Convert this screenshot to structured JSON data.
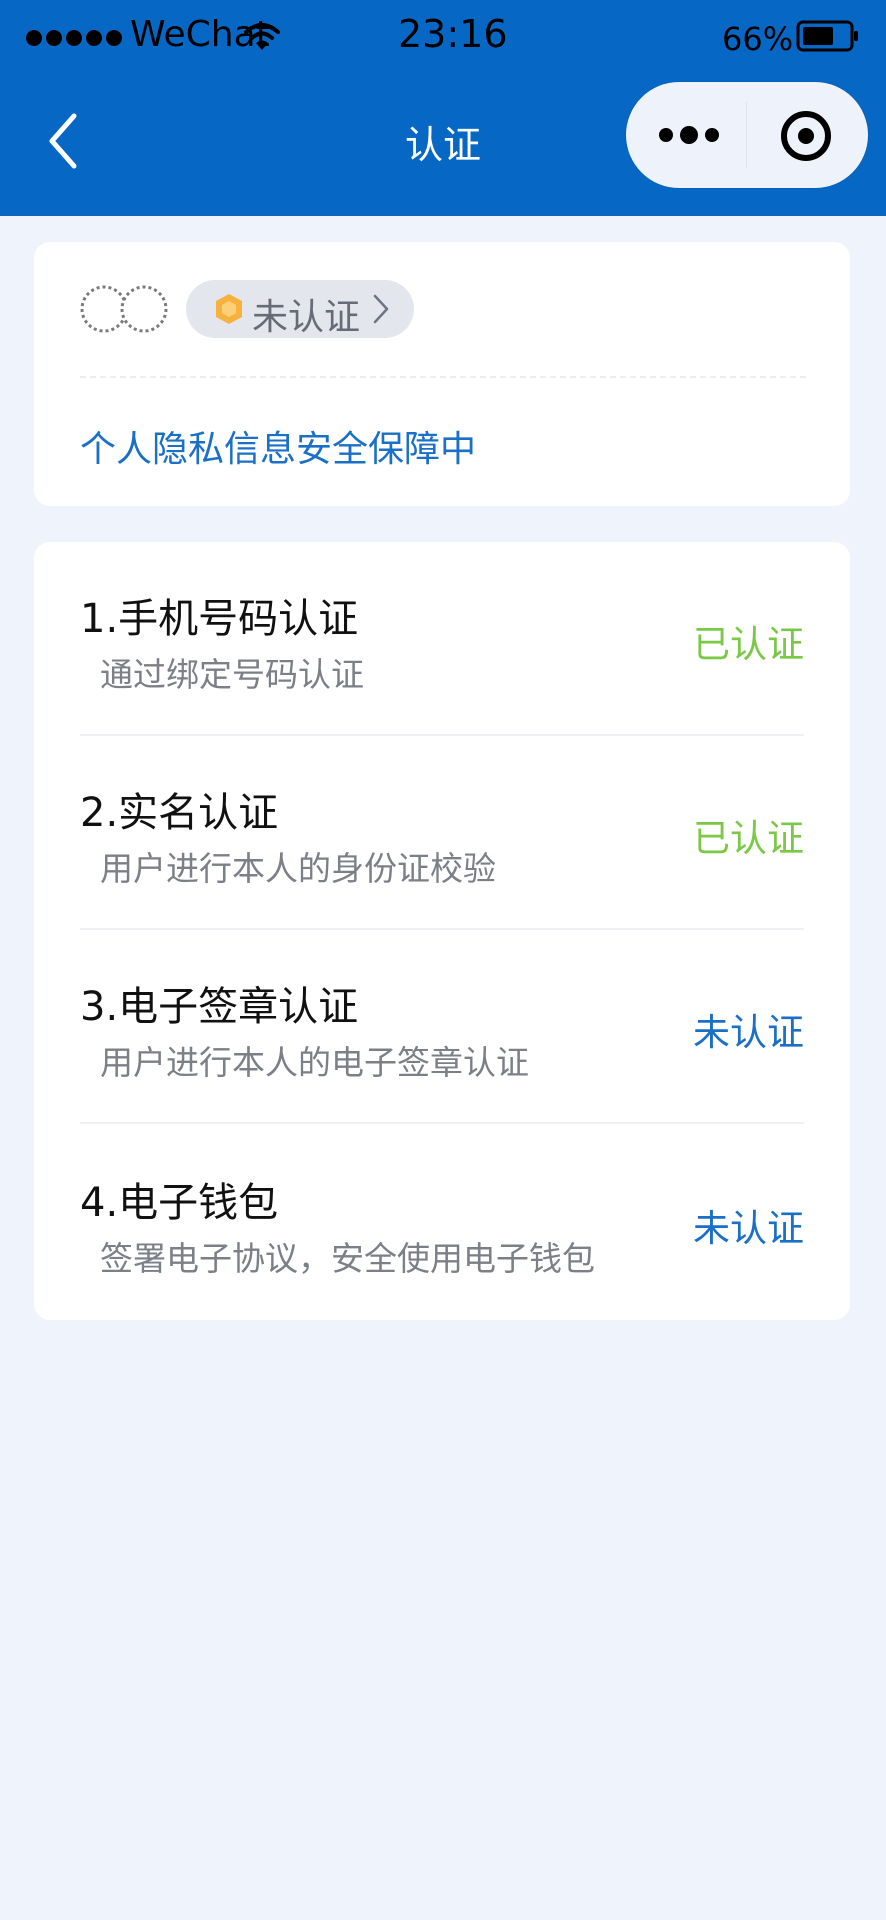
{
  "status_bar": {
    "carrier": "WeChat",
    "time": "23:16",
    "battery": "66%",
    "icons": [
      "signal-dots-icon",
      "wifi-icon",
      "battery-icon"
    ]
  },
  "nav": {
    "title": "认证",
    "icons": [
      "back-icon",
      "more-icon",
      "close-target-icon"
    ]
  },
  "user_card": {
    "badge_label": "未认证",
    "privacy_text": "个人隐私信息安全保障中",
    "icons": [
      "avatar",
      "shield-icon",
      "chevron-right-icon"
    ]
  },
  "verifications": [
    {
      "title": "1.手机号码认证",
      "desc": "通过绑定号码认证",
      "status": "已认证",
      "status_color": "#7ac846"
    },
    {
      "title": "2.实名认证",
      "desc": "用户进行本人的身份证校验",
      "status": "已认证",
      "status_color": "#7ac846"
    },
    {
      "title": "3.电子签章认证",
      "desc": "用户进行本人的电子签章认证",
      "status": "未认证",
      "status_color": "#1a6fc6"
    },
    {
      "title": "4.电子钱包",
      "desc": "签署电子协议，安全使用电子钱包",
      "status": "未认证",
      "status_color": "#1a6fc6"
    }
  ],
  "colors": {
    "header_bg": "#0668c4",
    "page_bg": "#eff3fb",
    "verified": "#7ac846",
    "unverified": "#1a6fc6"
  }
}
